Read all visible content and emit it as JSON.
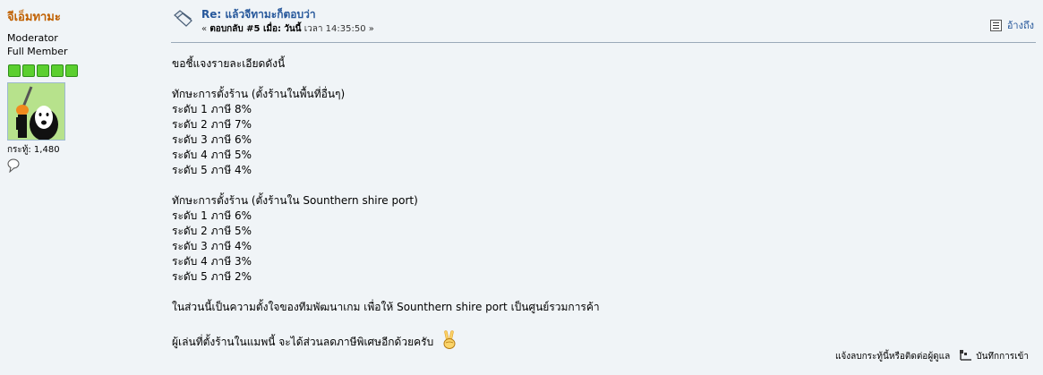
{
  "poster": {
    "name": "จีเอ็มทามะ",
    "role": "Moderator",
    "rank": "Full Member",
    "stars_count": 5,
    "posts_text": "กระทู้: 1,480"
  },
  "post": {
    "subject": "Re: แล้วจีทามะก็ตอบว่า",
    "meta_prefix": "«",
    "meta_reply": "ตอบกลับ #5 เมื่อ:",
    "meta_date": "วันนี้",
    "meta_time": "เวลา 14:35:50",
    "meta_suffix": "»",
    "quote_label": "อ้างถึง",
    "body": {
      "intro": "ขอชี้แจงรายละเอียดดังนี้",
      "section1_title": "ทักษะการตั้งร้าน (ตั้งร้านในพื้นที่อื่นๆ)",
      "section1_lines": [
        "ระดับ 1 ภาษี 8%",
        "ระดับ 2 ภาษี 7%",
        "ระดับ 3 ภาษี 6%",
        "ระดับ 4 ภาษี 5%",
        "ระดับ 5 ภาษี 4%"
      ],
      "section2_title": "ทักษะการตั้งร้าน (ตั้งร้านใน Sounthern shire port)",
      "section2_lines": [
        "ระดับ 1 ภาษี 6%",
        "ระดับ 2 ภาษี 5%",
        "ระดับ 3 ภาษี 4%",
        "ระดับ 4 ภาษี 3%",
        "ระดับ 5 ภาษี 2%"
      ],
      "note": "ในส่วนนี้เป็นความตั้งใจของทีมพัฒนาเกม เพื่อให้ Sounthern shire port เป็นศูนย์รวมการค้า",
      "closing": "ผู้เล่นที่ตั้งร้านในแมพนี้ จะได้ส่วนลดภาษีพิเศษอีกด้วยครับ"
    }
  },
  "footer": {
    "report_label": "แจ้งลบกระทู้นี้หรือติดต่อผู้ดูแล",
    "logged_label": "บันทึกการเข้า"
  },
  "colors": {
    "background": "#f0f4f7",
    "poster_name": "#c06000",
    "link": "#27589b",
    "star": "#5bcf2f"
  },
  "icons": {
    "post": "xx-post-icon",
    "quote": "quote-icon",
    "bubble": "speech-bubble-icon",
    "logged": "ip-log-icon",
    "emoticon": "victory-hand-emoticon"
  }
}
